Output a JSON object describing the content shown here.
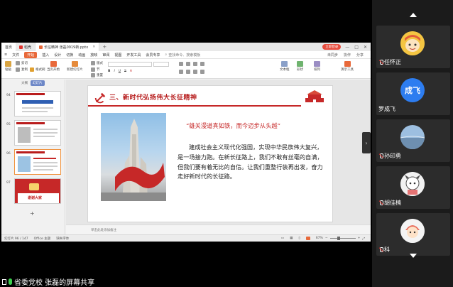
{
  "wps": {
    "tabs": {
      "home": "首页",
      "docer": "稻壳",
      "file": "长征精神 张磊0919新.pptx",
      "add": "+"
    },
    "login_label": "立即登录",
    "menu": [
      "文件",
      "开始",
      "插入",
      "设计",
      "切换",
      "动画",
      "放映",
      "审阅",
      "视图",
      "开发工具",
      "会员专享"
    ],
    "menu_active": "开始",
    "search_label": "查找命令、搜索模板",
    "menu_right": [
      "未同步",
      "协作",
      "分享"
    ],
    "ribbon": {
      "paste": "粘贴",
      "cut": "剪切",
      "copy": "复制",
      "format_painter": "格式刷",
      "from_current": "当页开始",
      "new_slide": "新建幻灯片",
      "layout": "版式",
      "section": "节",
      "reset": "重置",
      "textbox": "文本框",
      "shape": "形状",
      "arrange": "排列",
      "present": "演示工具"
    },
    "thumb_tabs": [
      "大纲",
      "幻灯片"
    ],
    "thumb_active": "幻灯片",
    "thumb_numbers": [
      "94",
      "95",
      "96",
      "97"
    ],
    "thumb_97_caption": "谢谢大家",
    "thumb_add": "+",
    "notes_placeholder": "单击此处添加备注",
    "status": {
      "slide_counter": "幻灯片 96 / 147",
      "theme": "Office 主题",
      "font_missing": "缺失字体",
      "zoom": "67%"
    }
  },
  "slide": {
    "title": "三、新时代弘扬伟大长征精神",
    "quote": "“雄关漫道真如铁，而今迈步从头越”",
    "paragraph": "建成社会主义现代化强国，实现中华民族伟大复兴，是一场接力跑。在新长征路上，我们不敢有丝毫的自满，但我们要有着无比的自信。让我们重整行装再出发，奋力走好新时代的长征路。"
  },
  "share_caption": "省委党校 张磊的屏幕共享",
  "participants": [
    {
      "name": "任怀正",
      "avatar": "cartoon-avatar",
      "color": "#f4c542"
    },
    {
      "name": "罗成飞",
      "avatar": "initials",
      "initials": "成飞",
      "color": "#2d7df0"
    },
    {
      "name": "孙印勇",
      "avatar": "landscape-avatar",
      "color": "#7fa3c8"
    },
    {
      "name": "胡佳楠",
      "avatar": "cartoon-avatar",
      "color": "#e6e6e6"
    },
    {
      "name": "科",
      "avatar": "cartoon-avatar",
      "color": "#f08a7a"
    }
  ],
  "colors": {
    "accent_red": "#c62828",
    "wps_orange": "#e8693a",
    "panel_bg": "#1b1b1b",
    "mic_active": "#3ccf4e"
  }
}
